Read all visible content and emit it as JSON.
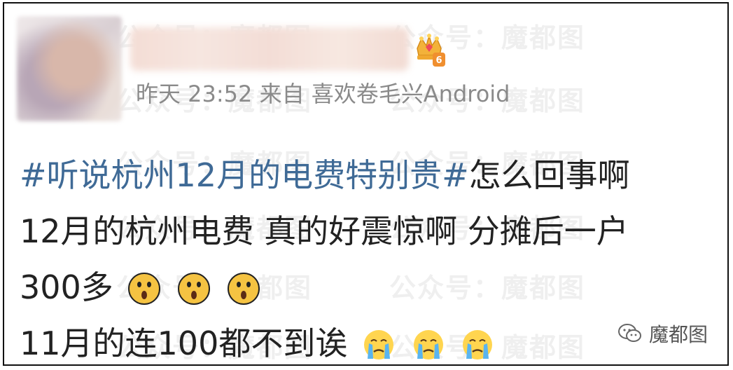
{
  "watermark_text": "公众号：魔都图",
  "post": {
    "timestamp": "昨天 23:52",
    "source_prefix": "来自",
    "source": "喜欢卷毛兴Android",
    "hashtag": "#听说杭州12月的电费特别贵#",
    "lines": [
      "怎么回事啊",
      "12月的杭州电费 真的好震惊啊 分摊后一户",
      "300多",
      "11月的连100都不到诶"
    ],
    "level_badge": "6"
  },
  "footer_mark": "魔都图",
  "icons": {
    "badge": "crown-level-icon",
    "shocked": "shocked-face-emoji",
    "crying": "crying-face-emoji",
    "wechat": "wechat-icon"
  },
  "colors": {
    "hashtag": "#3f6a96",
    "meta": "#8a8a8a",
    "text": "#222222"
  }
}
